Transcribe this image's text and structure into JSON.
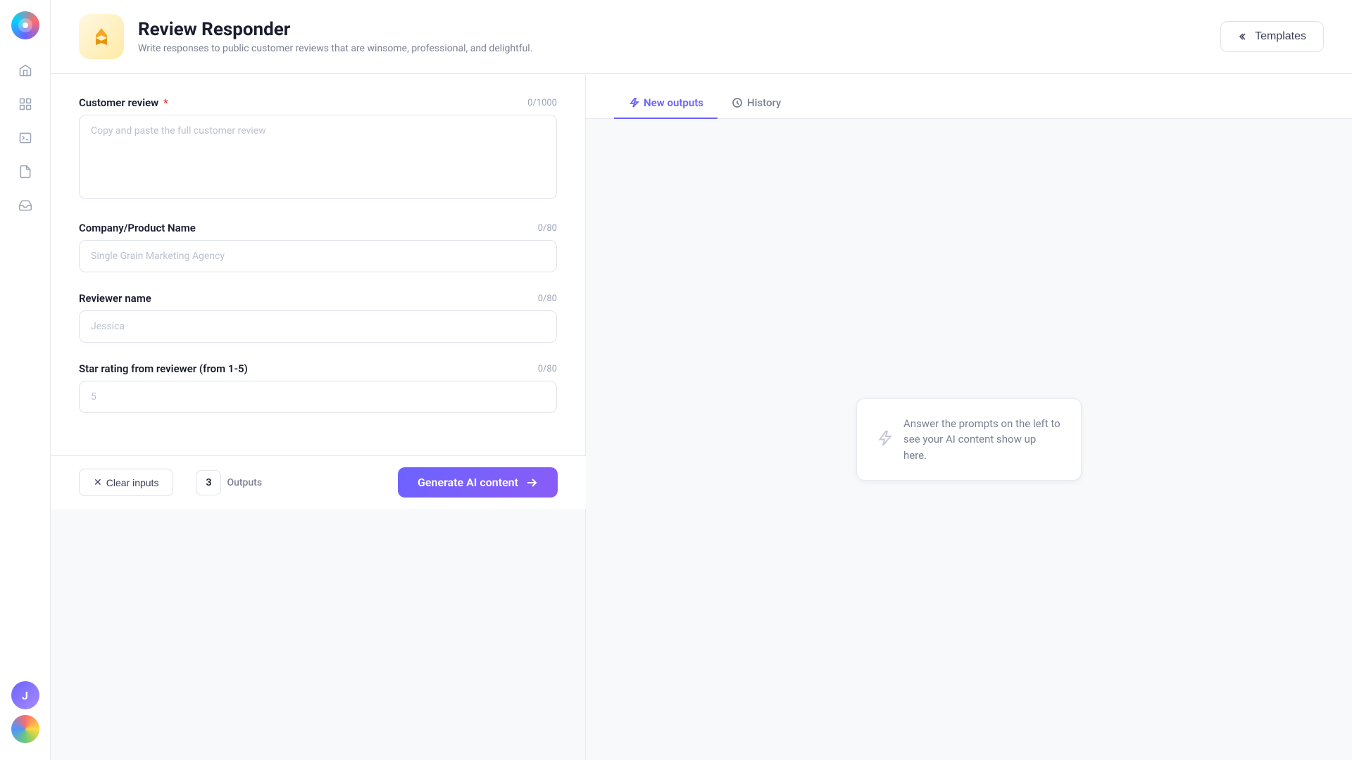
{
  "sidebar": {
    "logo_letter": "J",
    "items": [
      {
        "name": "home",
        "icon": "home"
      },
      {
        "name": "apps",
        "icon": "grid"
      },
      {
        "name": "terminal",
        "icon": "terminal"
      },
      {
        "name": "document",
        "icon": "document"
      },
      {
        "name": "inbox",
        "icon": "inbox"
      }
    ]
  },
  "header": {
    "title": "Review Responder",
    "subtitle": "Write responses to public customer reviews that are winsome, professional, and delightful.",
    "templates_button": "Templates"
  },
  "form": {
    "customer_review": {
      "label": "Customer review",
      "required": true,
      "placeholder": "Copy and paste the full customer review",
      "counter": "0/1000",
      "value": ""
    },
    "company_name": {
      "label": "Company/Product Name",
      "required": false,
      "placeholder": "Single Grain Marketing Agency",
      "counter": "0/80",
      "value": ""
    },
    "reviewer_name": {
      "label": "Reviewer name",
      "required": false,
      "placeholder": "Jessica",
      "counter": "0/80",
      "value": ""
    },
    "star_rating": {
      "label": "Star rating from reviewer (from 1-5)",
      "required": false,
      "placeholder": "5",
      "counter": "0/80",
      "value": ""
    }
  },
  "bottom_bar": {
    "clear_label": "Clear inputs",
    "outputs_count": "3",
    "outputs_label": "Outputs",
    "generate_label": "Generate AI content"
  },
  "right_panel": {
    "tab_new_outputs": "New outputs",
    "tab_history": "History",
    "empty_text": "Answer the prompts on the left to see your AI content show up here."
  }
}
